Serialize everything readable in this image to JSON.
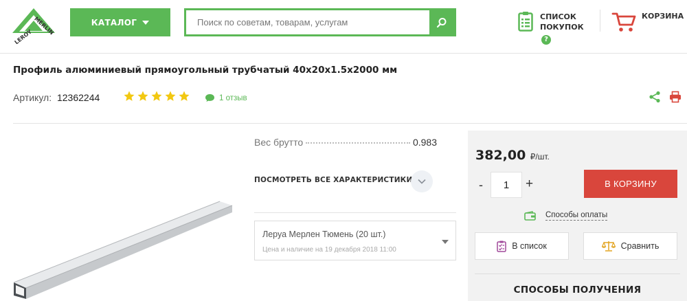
{
  "header": {
    "logo_text": "LEROY MERLIN",
    "catalog_label": "КАТАЛОГ",
    "search_placeholder": "Поиск по советам, товарам, услугам",
    "shoplist_line1": "СПИСОК",
    "shoplist_line2": "ПОКУПОК",
    "help_mark": "?",
    "cart_label": "КОРЗИНА"
  },
  "product": {
    "title": "Профиль алюминиевый прямоугольный трубчатый 40х20х1.5х2000 мм",
    "article_label": "Артикул:",
    "article_number": "12362244",
    "rating_stars": 5,
    "review_count_text": "1 отзыв"
  },
  "specs": {
    "weight_label": "Вес брутто",
    "weight_value": "0.983",
    "all_specs_link": "ПОСМОТРЕТЬ ВСЕ ХАРАКТЕРИСТИКИ"
  },
  "store": {
    "selected": "Леруа Мерлен Тюмень (20 шт.)",
    "note": "Цена и наличие на 19 декабря 2018 11:00"
  },
  "purchase": {
    "price": "382,00",
    "price_unit": "₽/шт.",
    "quantity": "1",
    "minus": "-",
    "plus": "+",
    "add_to_cart": "В КОРЗИНУ",
    "payment_link": "Способы оплаты",
    "to_list": "В список",
    "compare": "Сравнить",
    "delivery_title": "СПОСОБЫ ПОЛУЧЕНИЯ"
  },
  "colors": {
    "brand_green": "#5bb856",
    "cart_red": "#d9463c",
    "star_yellow": "#f2c811",
    "panel_bg": "#f2f2f2"
  },
  "icons": [
    "logo",
    "chevron-down-icon",
    "search-icon",
    "clipboard-list-icon",
    "help-icon",
    "cart-icon",
    "star-icon",
    "comment-icon",
    "share-icon",
    "print-icon",
    "wallet-icon",
    "checklist-icon",
    "scales-icon"
  ]
}
